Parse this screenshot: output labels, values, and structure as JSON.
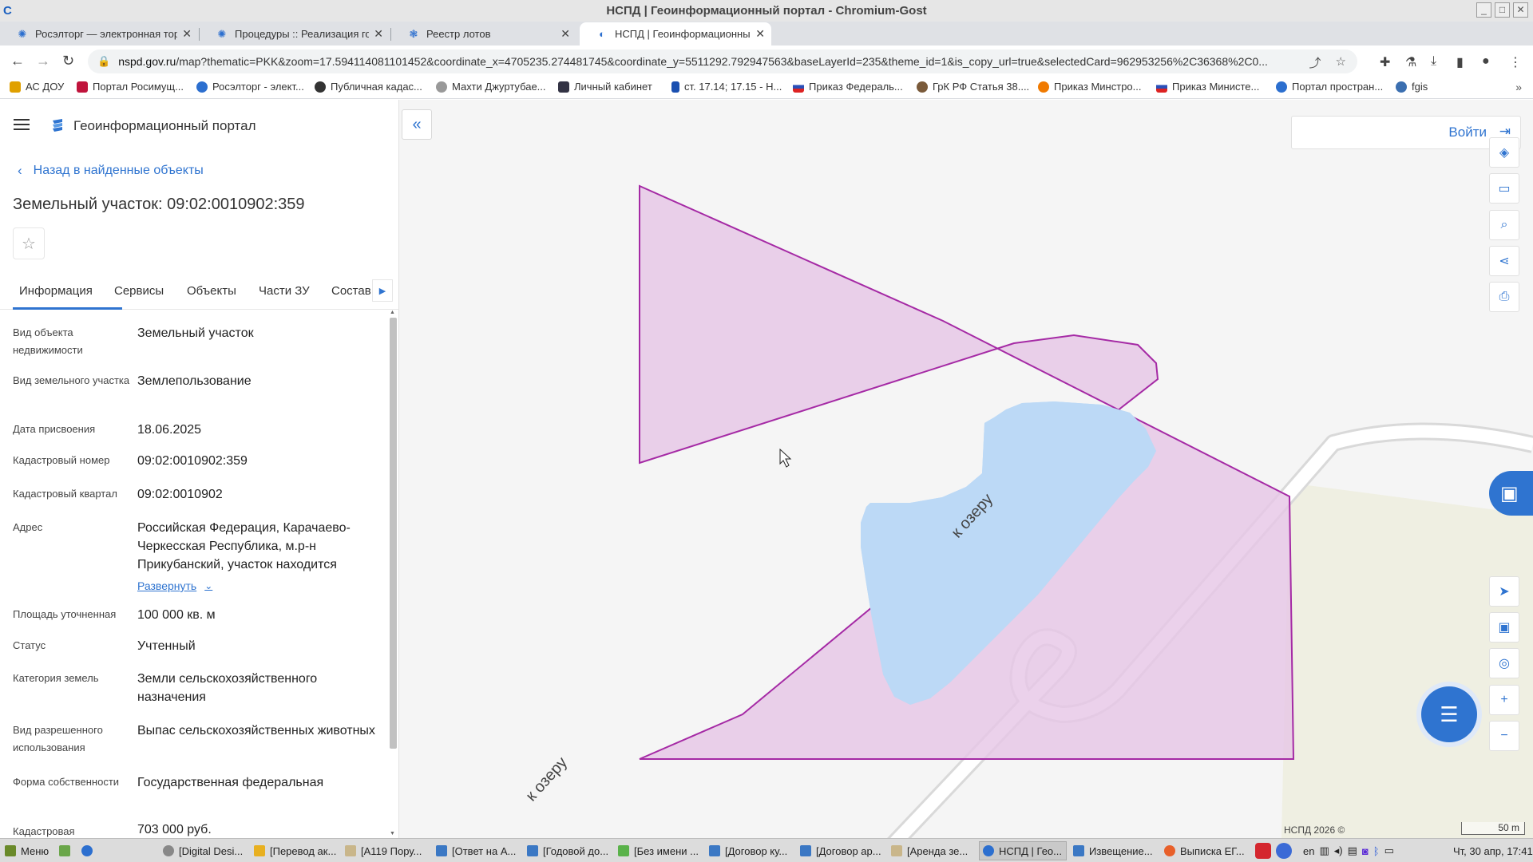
{
  "window": {
    "title": "НСПД | Геоинформационный портал - Chromium-Gost",
    "controls": [
      "_",
      "□",
      "✕"
    ]
  },
  "browser": {
    "tabs": [
      {
        "label": "Росэлторг — электронная тор",
        "active": false
      },
      {
        "label": "Процедуры :: Реализация гос",
        "active": false
      },
      {
        "label": "Реестр лотов",
        "active": false
      },
      {
        "label": "НСПД | Геоинформационный",
        "active": true
      }
    ],
    "url_host": "nspd.gov.ru",
    "url_rest": "/map?thematic=PKK&zoom=17.594114081101452&coordinate_x=4705235.274481745&coordinate_y=5511292.792947563&baseLayerId=235&theme_id=1&is_copy_url=true&selectedCard=962953256%2C36368%2C0...",
    "bookmarks": [
      "АС ДОУ",
      "Портал Росимущ...",
      "Росэлторг - элект...",
      "Публичная кадас...",
      "Махти Джуртубае...",
      "Личный кабинет",
      "ст. 17.14; 17.15 - Н...",
      "Приказ Федераль...",
      "ГрК РФ Статья 38....",
      "Приказ Минстро...",
      "Приказ Министе...",
      "Портал простран...",
      "fgis"
    ]
  },
  "panel": {
    "portal_name": "Геоинформационный портал",
    "back_link": "Назад в найденные объекты",
    "object_title": "Земельный участок: 09:02:0010902:359",
    "tabs": [
      "Информация",
      "Сервисы",
      "Объекты",
      "Части ЗУ",
      "Состав"
    ],
    "fields": [
      {
        "key": "Вид объекта недвижимости",
        "value": "Земельный участок"
      },
      {
        "key": "Вид земельного участка",
        "value": "Землепользование"
      },
      {
        "key": "Дата присвоения",
        "value": "18.06.2025"
      },
      {
        "key": "Кадастровый номер",
        "value": "09:02:0010902:359"
      },
      {
        "key": "Кадастровый квартал",
        "value": "09:02:0010902"
      },
      {
        "key": "Адрес",
        "value": "Российская Федерация, Карачаево-Черкесская Республика, м.р-н Прикубанский, участок находится"
      },
      {
        "key": "Площадь уточненная",
        "value": "100 000 кв. м"
      },
      {
        "key": "Статус",
        "value": "Учтенный"
      },
      {
        "key": "Категория земель",
        "value": "Земли сельскохозяйственного назначения"
      },
      {
        "key": "Вид разрешенного использования",
        "value": "Выпас сельскохозяйственных животных"
      },
      {
        "key": "Форма собственности",
        "value": "Государственная федеральная"
      },
      {
        "key": "Кадастровая",
        "value": "703 000 руб."
      }
    ],
    "expand_label": "Развернуть"
  },
  "map": {
    "login_label": "Войти",
    "road_label_1": "к озеру",
    "road_label_2": "к озеру",
    "attribution": "НСПД 2026 ©",
    "scale_label": "50 m",
    "parcel_fill": "#e6c6e6",
    "parcel_stroke": "#a52aa5",
    "water_color": "#bcd9f6"
  },
  "taskbar": {
    "menu_label": "Меню",
    "items": [
      "[Digital Desi...",
      "[Перевод ак...",
      "[A119 Пору...",
      "[Ответ на А...",
      "[Годовой до...",
      "[Без имени ...",
      "[Договор ку...",
      "[Договор ар...",
      "[Аренда зе...",
      "НСПД | Гео...",
      "Извещение...",
      "Выписка ЕГ..."
    ],
    "lang": "en",
    "clock": "Чт, 30 апр, 17:41"
  }
}
